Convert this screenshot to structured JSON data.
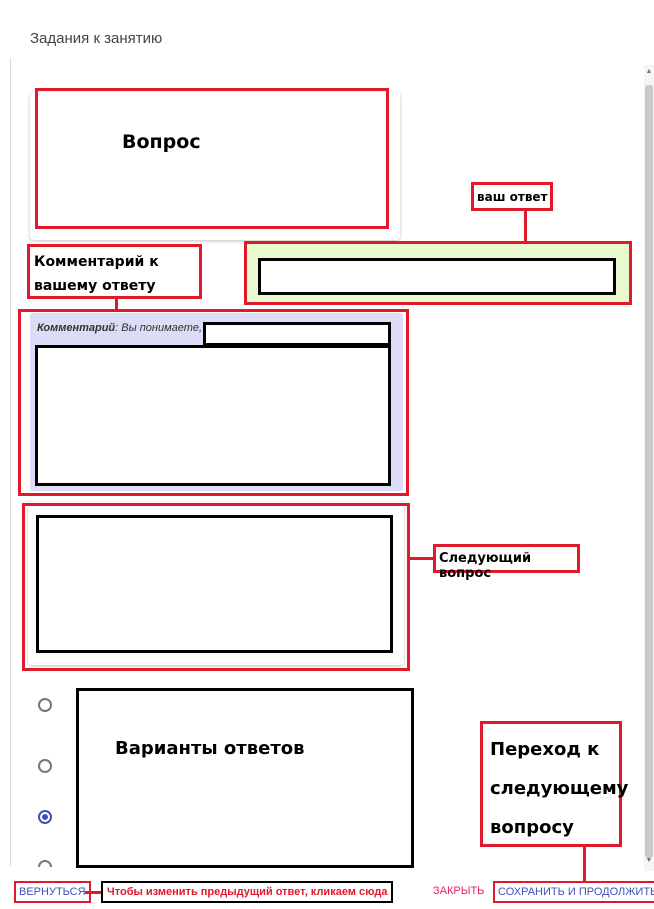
{
  "header": {
    "title": "Задания к занятию"
  },
  "question": {
    "label": "Вопрос"
  },
  "answer": {
    "callout": "ваш ответ"
  },
  "comment": {
    "callout": "Комментарий к вашему ответу",
    "prefix": "Комментарий",
    "text": ": Вы понимаете,"
  },
  "next_question": {
    "callout": "Следующий вопрос"
  },
  "options": {
    "label": "Варианты ответов",
    "items": [
      {
        "checked": false
      },
      {
        "checked": false
      },
      {
        "checked": true
      },
      {
        "checked": false
      }
    ]
  },
  "next_step": {
    "callout": "Переход к следующему вопросу"
  },
  "footer": {
    "back_label": "ВЕРНУТЬСЯ",
    "back_hint": "Чтобы изменить предыдущий ответ, кликаем сюда",
    "close_label": "ЗАКРЫТЬ",
    "save_label": "СОХРАНИТЬ И ПРОДОЛЖИТЬ"
  },
  "colors": {
    "annotation": "#e0192b",
    "accent": "#3f51b5",
    "answer_bg": "#e8f8cf",
    "comment_bg": "#dcdcf7"
  }
}
